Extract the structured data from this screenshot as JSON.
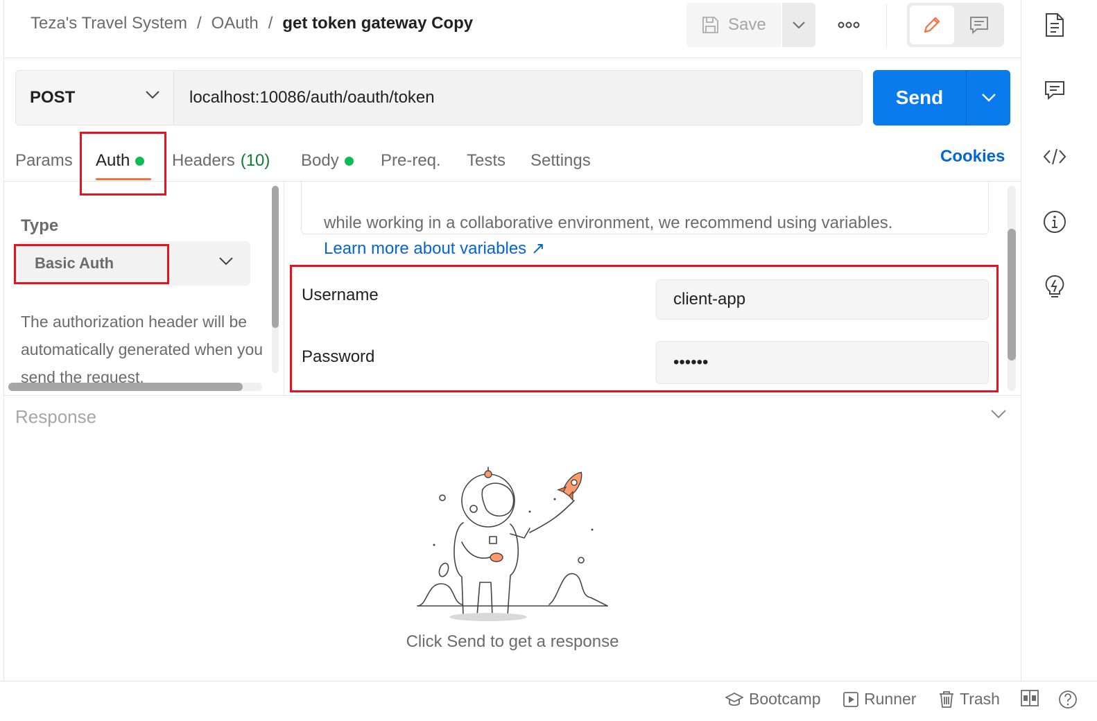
{
  "breadcrumb": {
    "workspace": "Teza's Travel System",
    "separator": "/",
    "folder": "OAuth",
    "request": "get token gateway Copy"
  },
  "header": {
    "save_label": "Save"
  },
  "request": {
    "method": "POST",
    "url": "localhost:10086/auth/oauth/token",
    "send_label": "Send"
  },
  "tabs": {
    "params": "Params",
    "auth": "Auth",
    "headers": "Headers",
    "headers_count": "(10)",
    "body": "Body",
    "prereq": "Pre-req.",
    "tests": "Tests",
    "settings": "Settings"
  },
  "cookies_label": "Cookies",
  "auth": {
    "type_label": "Type",
    "type_value": "Basic Auth",
    "description": "The authorization header will be automatically generated when you send the request.",
    "info_text": "while working in a collaborative environment, we recommend using variables.",
    "info_link": "Learn more about variables ↗",
    "username_label": "Username",
    "username_value": "client-app",
    "password_label": "Password",
    "password_value": "••••••"
  },
  "response": {
    "title": "Response",
    "empty_message": "Click Send to get a response"
  },
  "footer": {
    "bootcamp": "Bootcamp",
    "runner": "Runner",
    "trash": "Trash"
  },
  "colors": {
    "accent": "#ff6c37",
    "send": "#097bed",
    "link": "#0265d2",
    "active_dot": "#0cbb52",
    "annotation": "#e8121f"
  }
}
